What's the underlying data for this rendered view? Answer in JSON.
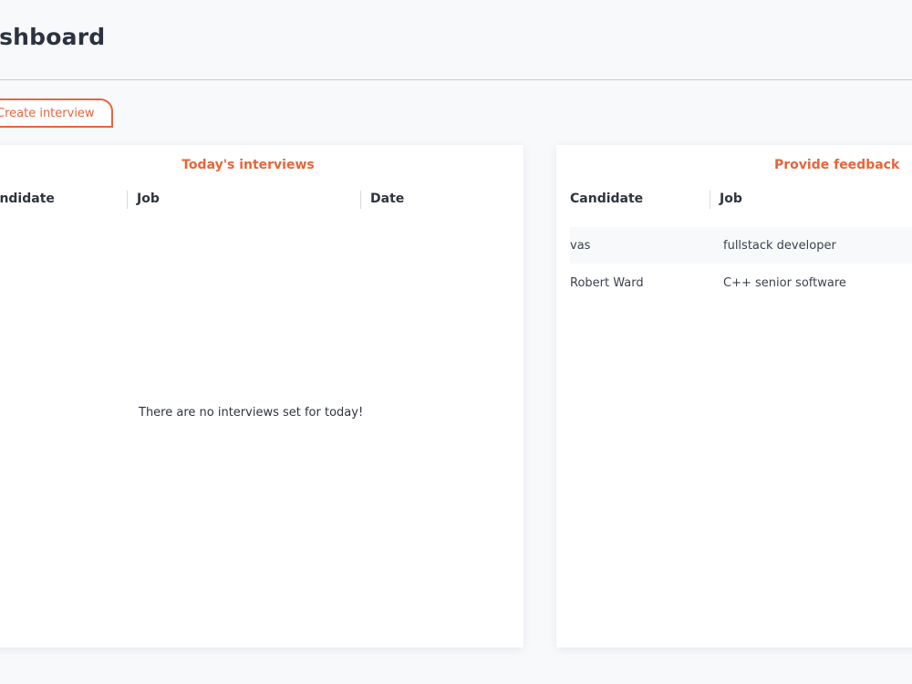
{
  "header": {
    "title": "ashboard"
  },
  "actions": {
    "create_interview_label": "Create interview"
  },
  "todays_interviews": {
    "title": "Today's interviews",
    "columns": [
      "andidate",
      "Job",
      "Date"
    ],
    "empty_message": "There are no interviews set for today!"
  },
  "provide_feedback": {
    "title": "Provide feedback",
    "columns": [
      "Candidate",
      "Job"
    ],
    "rows": [
      {
        "candidate": "vas",
        "job": "fullstack developer"
      },
      {
        "candidate": "Robert Ward",
        "job": "C++ senior software"
      }
    ]
  },
  "colors": {
    "accent": "#e8643a",
    "background": "#f7f9fb",
    "card": "#ffffff",
    "text": "#2e3440"
  }
}
